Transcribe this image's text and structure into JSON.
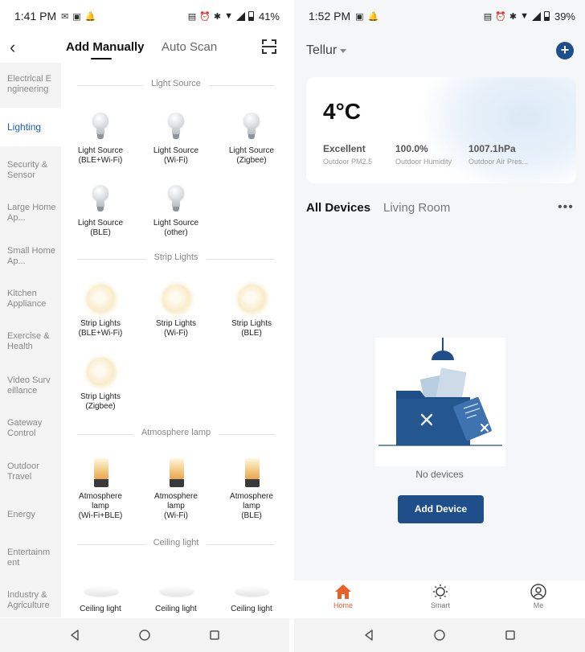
{
  "left": {
    "status": {
      "time": "1:41 PM",
      "battery": "41%"
    },
    "header": {
      "tab_active": "Add Manually",
      "tab_other": "Auto Scan"
    },
    "categories": [
      "Electrical E ngineering",
      "Lighting",
      "Security & Sensor",
      "Large Home Ap...",
      "Small Home Ap...",
      "Kitchen Appliance",
      "Exercise & Health",
      "Video Surv eillance",
      "Gateway Control",
      "Outdoor Travel",
      "Energy",
      "Entertainm ent",
      "Industry & Agriculture"
    ],
    "sections": [
      "Light Source",
      "Strip Lights",
      "Atmosphere lamp",
      "Ceiling light"
    ],
    "devices": {
      "light": [
        [
          "Light Source",
          "(BLE+Wi-Fi)"
        ],
        [
          "Light Source",
          "(Wi-Fi)"
        ],
        [
          "Light Source",
          "(Zigbee)"
        ],
        [
          "Light Source",
          "(BLE)"
        ],
        [
          "Light Source",
          "(other)"
        ]
      ],
      "strip": [
        [
          "Strip Lights",
          "(BLE+Wi-Fi)"
        ],
        [
          "Strip Lights",
          "(Wi-Fi)"
        ],
        [
          "Strip Lights",
          "(BLE)"
        ],
        [
          "Strip Lights",
          "(Zigbee)"
        ]
      ],
      "lamp": [
        [
          "Atmosphere",
          "lamp",
          "(Wi-Fi+BLE)"
        ],
        [
          "Atmosphere",
          "lamp",
          "(Wi-Fi)"
        ],
        [
          "Atmosphere",
          "lamp",
          "(BLE)"
        ]
      ],
      "ceiling": [
        "Ceiling light",
        "Ceiling light",
        "Ceiling light"
      ]
    }
  },
  "right": {
    "status": {
      "time": "1:52 PM",
      "battery": "39%"
    },
    "home_name": "Tellur",
    "weather": {
      "temp": "4°C",
      "stats": [
        {
          "value": "Excellent",
          "label": "Outdoor PM2.5"
        },
        {
          "value": "100.0%",
          "label": "Outdoor Humidity"
        },
        {
          "value": "1007.1hPa",
          "label": "Outdoor Air Pres..."
        }
      ]
    },
    "tabs": {
      "all": "All Devices",
      "living": "Living Room"
    },
    "empty_text": "No devices",
    "add_device": "Add Device",
    "bottom_tabs": {
      "home": "Home",
      "smart": "Smart",
      "me": "Me"
    },
    "colors": {
      "accent": "#1f4f8a",
      "active_tab": "#e8602a"
    }
  }
}
